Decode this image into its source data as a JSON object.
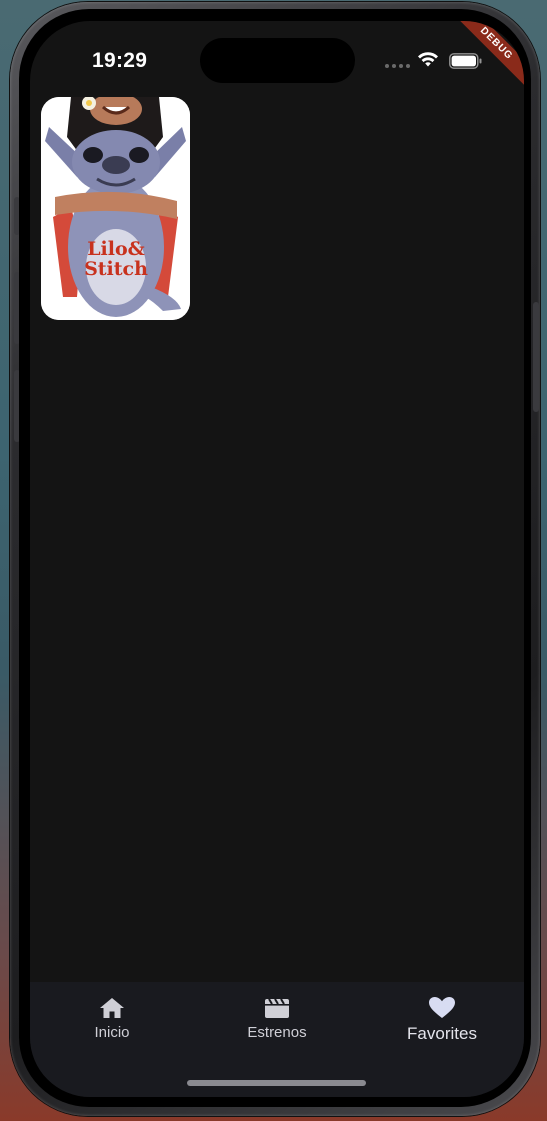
{
  "status_bar": {
    "time": "19:29",
    "icons": [
      "cellular-dots-icon",
      "wifi-icon",
      "battery-icon"
    ]
  },
  "debug_banner": {
    "label": "DEBUG",
    "color": "#8a2a1a"
  },
  "favorites": {
    "items": [
      {
        "poster_logo_line1": "Lilo&",
        "poster_logo_line2": "Stitch",
        "poster_logo_color": "#c8321e"
      }
    ]
  },
  "bottom_nav": {
    "items": [
      {
        "label": "Inicio",
        "icon": "home-icon"
      },
      {
        "label": "Estrenos",
        "icon": "clapperboard-icon"
      },
      {
        "label": "Favorites",
        "icon": "heart-icon"
      }
    ],
    "active_label": "Favorites",
    "background": "#191a1f"
  },
  "colors": {
    "screen_background": "#141414"
  }
}
